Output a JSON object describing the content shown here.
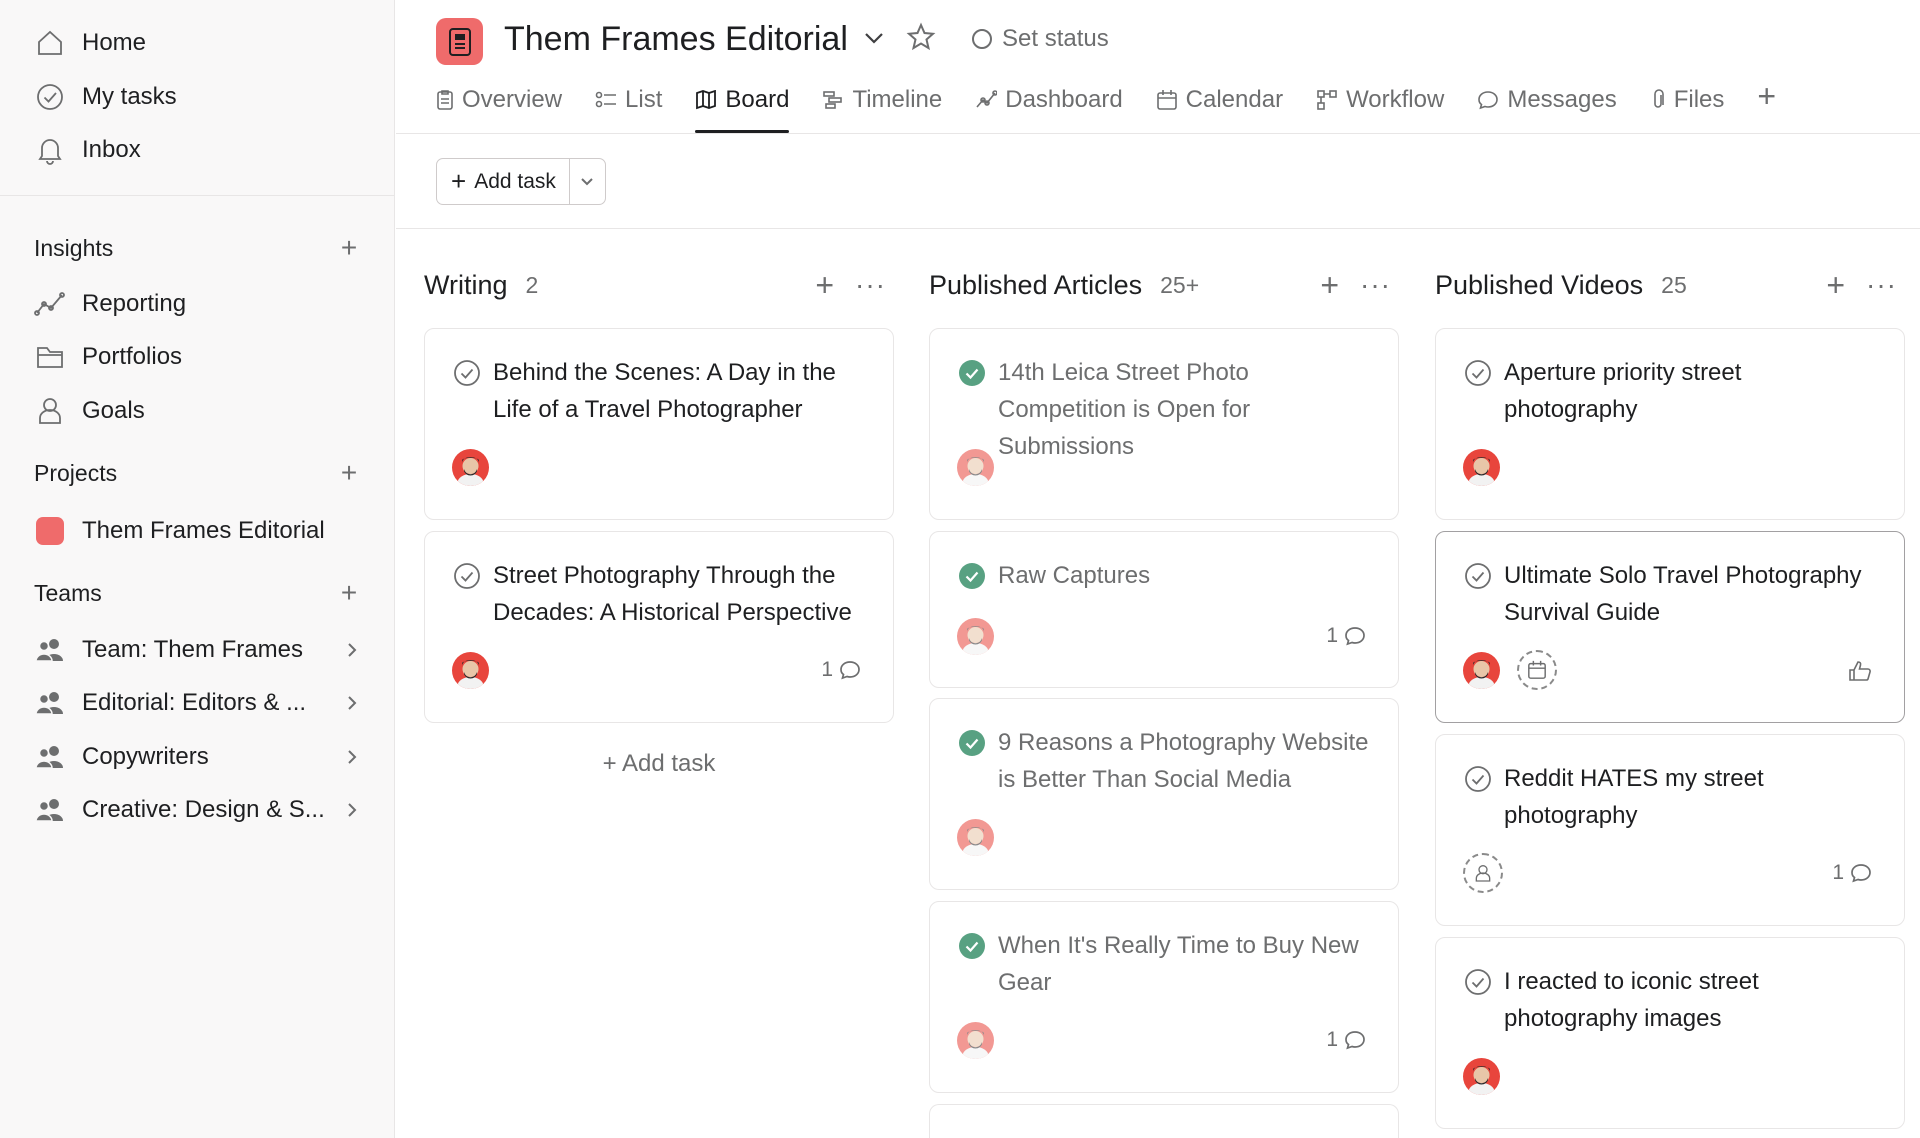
{
  "sidebar": {
    "top_nav": [
      {
        "label": "Home",
        "icon": "home-icon"
      },
      {
        "label": "My tasks",
        "icon": "check-circle-icon"
      },
      {
        "label": "Inbox",
        "icon": "bell-icon"
      }
    ],
    "insights": {
      "heading": "Insights",
      "items": [
        {
          "label": "Reporting",
          "icon": "reporting-icon"
        },
        {
          "label": "Portfolios",
          "icon": "folder-icon"
        },
        {
          "label": "Goals",
          "icon": "goals-icon"
        }
      ]
    },
    "projects": {
      "heading": "Projects",
      "items": [
        {
          "label": "Them Frames Editorial",
          "color": "#ef6b6b"
        }
      ]
    },
    "teams": {
      "heading": "Teams",
      "items": [
        {
          "label": "Team: Them Frames"
        },
        {
          "label": "Editorial: Editors & ..."
        },
        {
          "label": "Copywriters"
        },
        {
          "label": "Creative: Design & S..."
        }
      ]
    }
  },
  "header": {
    "title": "Them Frames Editorial",
    "set_status": "Set status",
    "tabs": [
      {
        "label": "Overview",
        "icon": "overview-icon"
      },
      {
        "label": "List",
        "icon": "list-icon"
      },
      {
        "label": "Board",
        "icon": "board-icon",
        "active": true
      },
      {
        "label": "Timeline",
        "icon": "timeline-icon"
      },
      {
        "label": "Dashboard",
        "icon": "dashboard-icon"
      },
      {
        "label": "Calendar",
        "icon": "calendar-icon"
      },
      {
        "label": "Workflow",
        "icon": "workflow-icon"
      },
      {
        "label": "Messages",
        "icon": "messages-icon"
      },
      {
        "label": "Files",
        "icon": "paperclip-icon"
      }
    ]
  },
  "toolbar": {
    "add_task_label": "Add task"
  },
  "colors": {
    "accent": "#ef6b6b",
    "complete_green": "#58a182",
    "muted": "#6d6e6f"
  },
  "board": {
    "columns": [
      {
        "title": "Writing",
        "count": "2",
        "add_task_label": "Add task",
        "cards": [
          {
            "title": "Behind the Scenes: A Day in the Life of a Travel Photographer",
            "done": false
          },
          {
            "title": "Street Photography Through the Decades: A Historical Perspective",
            "done": false,
            "comments": "1"
          }
        ]
      },
      {
        "title": "Published Articles",
        "count": "25+",
        "cards": [
          {
            "title": "14th Leica Street Photo Competition is Open for Submissions",
            "done": true
          },
          {
            "title": "Raw Captures",
            "done": true,
            "comments": "1"
          },
          {
            "title": "9 Reasons a Photography Website is Better Than Social Media",
            "done": true
          },
          {
            "title": "When It's Really Time to Buy New Gear",
            "done": true,
            "comments": "1"
          }
        ]
      },
      {
        "title": "Published Videos",
        "count": "25",
        "cards": [
          {
            "title": "Aperture priority street photography",
            "done": false
          },
          {
            "title": "Ultimate Solo Travel Photography Survival Guide",
            "done": false,
            "selected": true
          },
          {
            "title": "Reddit HATES my street photography",
            "done": false,
            "comments": "1",
            "unassigned": true
          },
          {
            "title": "I reacted to iconic street photography images",
            "done": false
          }
        ]
      }
    ]
  }
}
